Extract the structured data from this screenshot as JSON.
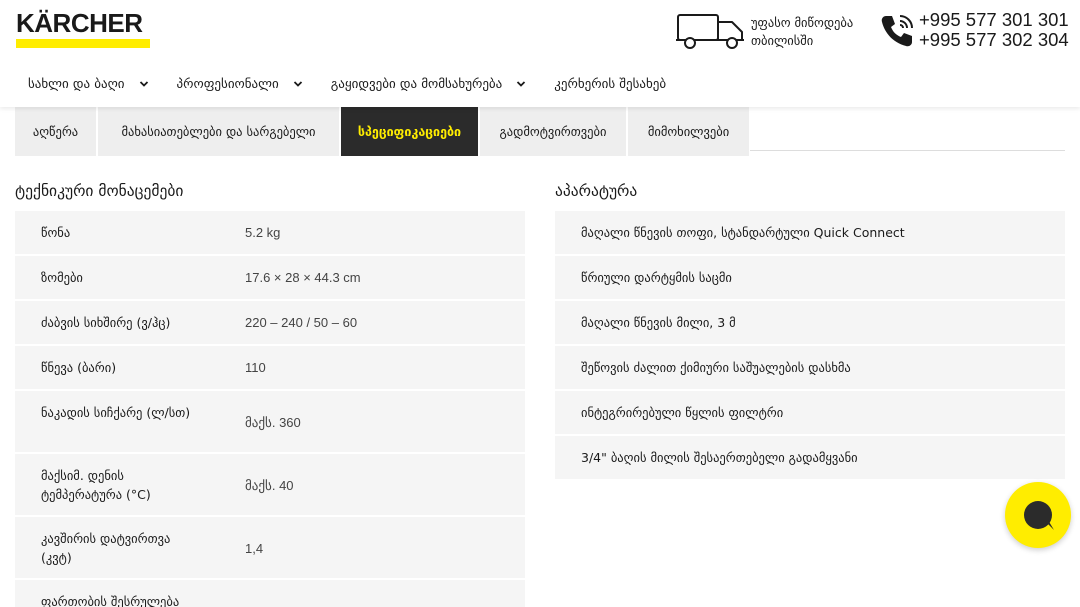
{
  "header": {
    "logo_text": "KÄRCHER",
    "delivery_line1": "უფასო მიწოდება",
    "delivery_line2": "თბილისში",
    "phone1": "+995 577 301 301",
    "phone2": "+995 577 302 304"
  },
  "nav": {
    "items": [
      {
        "label": "სახლი და ბაღი"
      },
      {
        "label": "პროფესიონალი"
      },
      {
        "label": "გაყიდვები და მომსახურება"
      },
      {
        "label": "კერხერის შესახებ"
      }
    ]
  },
  "tabs": [
    {
      "label": "აღწერა",
      "active": false
    },
    {
      "label": "მახასიათებლები და სარგებელი",
      "active": false
    },
    {
      "label": "სპეციფიკაციები",
      "active": true
    },
    {
      "label": "გადმოტვირთვები",
      "active": false
    },
    {
      "label": "მიმოხილვები",
      "active": false
    }
  ],
  "specs": {
    "title": "ტექნიკური მონაცემები",
    "rows": [
      {
        "label": "წონა",
        "value": "5.2 kg"
      },
      {
        "label": "ზომები",
        "value": "17.6 × 28 × 44.3 cm"
      },
      {
        "label": "ძაბვის სიხშირე (ვ/ჰც)",
        "value": "220 – 240 / 50 – 60"
      },
      {
        "label": "წნევა (ბარი)",
        "value": "110"
      },
      {
        "label": "ნაკადის სიჩქარე (ლ/სთ)",
        "value": "მაქს. 360"
      },
      {
        "label": "მაქსიმ. დენის ტემპერატურა (°C)",
        "value": "მაქს. 40"
      },
      {
        "label": "კავშირის დატვირთვა (კვტ)",
        "value": "1,4"
      },
      {
        "label": "ფართობის შესრულება",
        "value": ""
      }
    ]
  },
  "equipment": {
    "title": "აპარატურა",
    "items": [
      {
        "label": "მაღალი წნევის თოფი, სტანდარტული Quick Connect"
      },
      {
        "label": "წრიული დარტყმის საცმი"
      },
      {
        "label": "მაღალი წნევის მილი, 3 მ"
      },
      {
        "label": "შეწოვის ძალით ქიმიური საშუალების დასხმა"
      },
      {
        "label": "ინტეგრირებული წყლის ფილტრი"
      },
      {
        "label": "3/4\" ბაღის მილის შესაერთებელი გადამყვანი"
      }
    ]
  },
  "colors": {
    "brand_yellow": "#ffed00",
    "dark": "#2b2b2b",
    "row_bg": "#f5f5f5"
  }
}
